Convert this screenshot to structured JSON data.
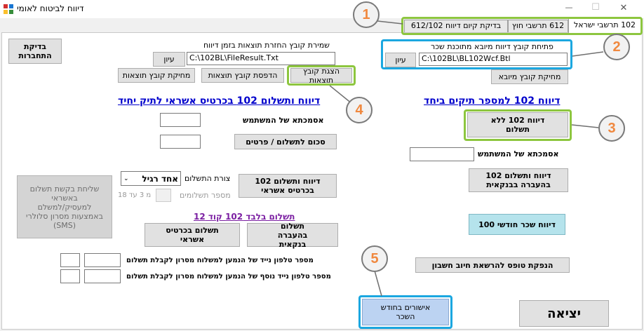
{
  "window": {
    "title": "דיווח לביטוח לאומי",
    "minimize_glyph": "—",
    "maximize_glyph": "☐",
    "close_glyph": "✕"
  },
  "tabs": [
    {
      "label": "102 תרשבי ישראל"
    },
    {
      "label": "612 תרשבי חוץ"
    },
    {
      "label": "בדיקת קיום דיווח 612/102"
    }
  ],
  "import": {
    "label": "פתיחת קובץ דיווח מיובא מתוכנת שכר",
    "value": "C:\\102BL\\BL102Wcf.Btl",
    "browse_label": "עיון",
    "delete_label": "מחיקת קובץ מיובא"
  },
  "results": {
    "label": "שמירת קובץ החזרת תוצאות בזמן דיווח",
    "value": "C:\\102BL\\FileResult.Txt",
    "browse_label": "עיון",
    "show_label": "הצגת קובץ תוצאות",
    "print_label": "הדפסת קובץ תוצאות",
    "delete_label": "מחיקת קובץ תוצאות"
  },
  "connection_check_label": "בדיקת התחברות",
  "single_employer": {
    "heading": "דיווח 102 למספר תיקים ביחד",
    "report_no_payment_label": "דיווח 102 ללא תשלום",
    "user_ref_label": "אסמכתא של המשתמש",
    "user_ref_value": "",
    "report_bank_transfer_label": "דיווח ותשלום 102 בהעברה בבנקאית",
    "monthly_salary_label": "דיווח שכר חודשי 100",
    "direct_debit_label": "הנפקת טופס להרשאת חיוב חשבון"
  },
  "credit_card": {
    "heading": "דיווח ותשלום 102 בכרטיס אשראי לתיק יחיד",
    "user_ref_label": "אסמכתא של המשתמש",
    "user_ref_value": "",
    "amount_value": "",
    "amount_button_label": "סכום לתשלום / פרטים",
    "report_credit_label": "דיווח ותשלום 102 בכרטיס אשראי",
    "payment_form_label": "צורת התשלום",
    "payment_form_value": "אחד רגיל",
    "installments_label": "מספר תשלומים",
    "installments_value": "",
    "installments_hint": "מ 3 עד 18",
    "sms_label": "שליחת בקשת תשלום באשראי למעסיק/למשלם באמצעות מסרון סלולרי (SMS)"
  },
  "payment_only": {
    "heading": "תשלום בלבד 102 קוד 12",
    "bank_transfer_label": "תשלום בהעברה בנקאית",
    "credit_label": "תשלום בכרטיס אשראי",
    "phone1_label": "מספר טלפון נייד של הנמען למשלוח מסרון לקבלת תשלום",
    "phone1_prefix": "",
    "phone1_number": "",
    "phone2_label": "מספר טלפון נייד נוסף של הנמען למשלוח מסרון לקבלת תשלום",
    "phone2_prefix": "",
    "phone2_number": ""
  },
  "monthly_confirmations_label": "אישורים בחודש השכר",
  "exit_label": "יציאה",
  "annotations": [
    "1",
    "2",
    "3",
    "4",
    "5"
  ],
  "colors": {
    "accent_green": "#8dc63f",
    "accent_blue": "#1ba7e0",
    "link_blue": "#0000cc",
    "purple": "#7b1fa2",
    "callout_number": "#f0883e"
  }
}
